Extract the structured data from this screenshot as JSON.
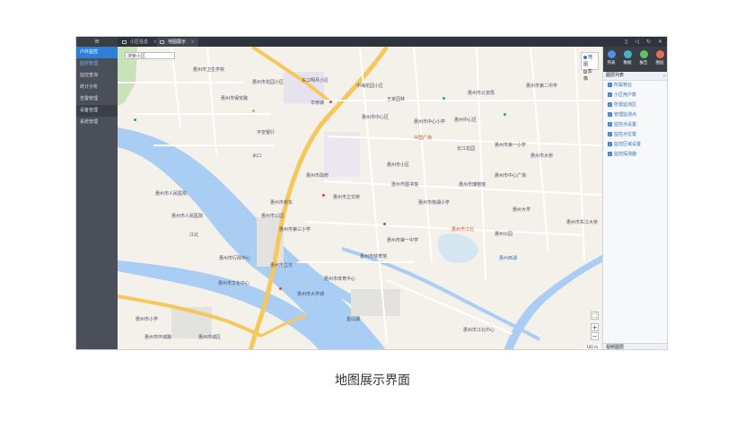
{
  "sidebar": {
    "logo": "≡",
    "items": [
      {
        "label": "户外监控"
      },
      {
        "label": "监控管理"
      },
      {
        "label": "监控查询"
      },
      {
        "label": "统计分析"
      },
      {
        "label": "告警管理"
      },
      {
        "label": "设备管理"
      },
      {
        "label": "系统管理"
      }
    ]
  },
  "tabs": [
    {
      "label": "小区信息"
    },
    {
      "label": "地图展示"
    }
  ],
  "tab_close": "×",
  "top_icons": "▯ ◁ ↻ ✕",
  "map": {
    "search_placeholder": "搜索小区",
    "type_options": [
      "地图",
      "影像"
    ],
    "zoom_in": "+",
    "zoom_out": "−",
    "fullscreen": "⛶",
    "scale": "100 m",
    "labels": [
      "惠州市卫生学校",
      "惠州市花园小区",
      "东江明月小区",
      "中海花园小区",
      "王家园林",
      "惠州市保安路",
      "华侨城",
      "惠州市中心区",
      "平安银行",
      "惠州市中心小学",
      "惠州中心区",
      "中国广场",
      "长江花园",
      "惠州市第一小学",
      "惠州市人民医院",
      "惠州市人民医院",
      "惠州市政府",
      "惠州市小区",
      "惠州市图书馆",
      "惠州市博物馆",
      "惠州市行政中心",
      "惠州市文化中心",
      "江北",
      "惠州市第三小学",
      "惠州市体育馆",
      "惠州市大学城",
      "惠州市江北",
      "水口",
      "惠州市桥东",
      "惠州市第一中学",
      "惠州西湖",
      "惠州公园",
      "惠州市小学",
      "惠州市环城路",
      "金山湖",
      "惠州市江北中心",
      "惠州市东江大桥",
      "惠州大学",
      "惠州市中心广场",
      "惠州市南湖小学",
      "惠州市体育中心",
      "惠州市立交",
      "惠州市立交桥",
      "惠州市公园",
      "惠州市大桥",
      "惠州市公安局",
      "惠州市第二中学",
      "惠州市城区"
    ]
  },
  "panel": {
    "buttons": [
      {
        "label": "列表",
        "color": "#4f8fe0"
      },
      {
        "label": "数据",
        "color": "#3fb5c9"
      },
      {
        "label": "报告",
        "color": "#5cc45b"
      },
      {
        "label": "图层",
        "color": "#e86d5b"
      }
    ],
    "layers_title": "图层列表",
    "layers": [
      {
        "label": "所属物业"
      },
      {
        "label": "小区用户数"
      },
      {
        "label": "所需监测区"
      },
      {
        "label": "管理监测点"
      },
      {
        "label": "监控点设置"
      },
      {
        "label": "监控点位置"
      },
      {
        "label": "监控区域设置"
      },
      {
        "label": "监控探测器"
      }
    ],
    "bottom_label": "视频图层"
  },
  "caption": "地图展示界面"
}
